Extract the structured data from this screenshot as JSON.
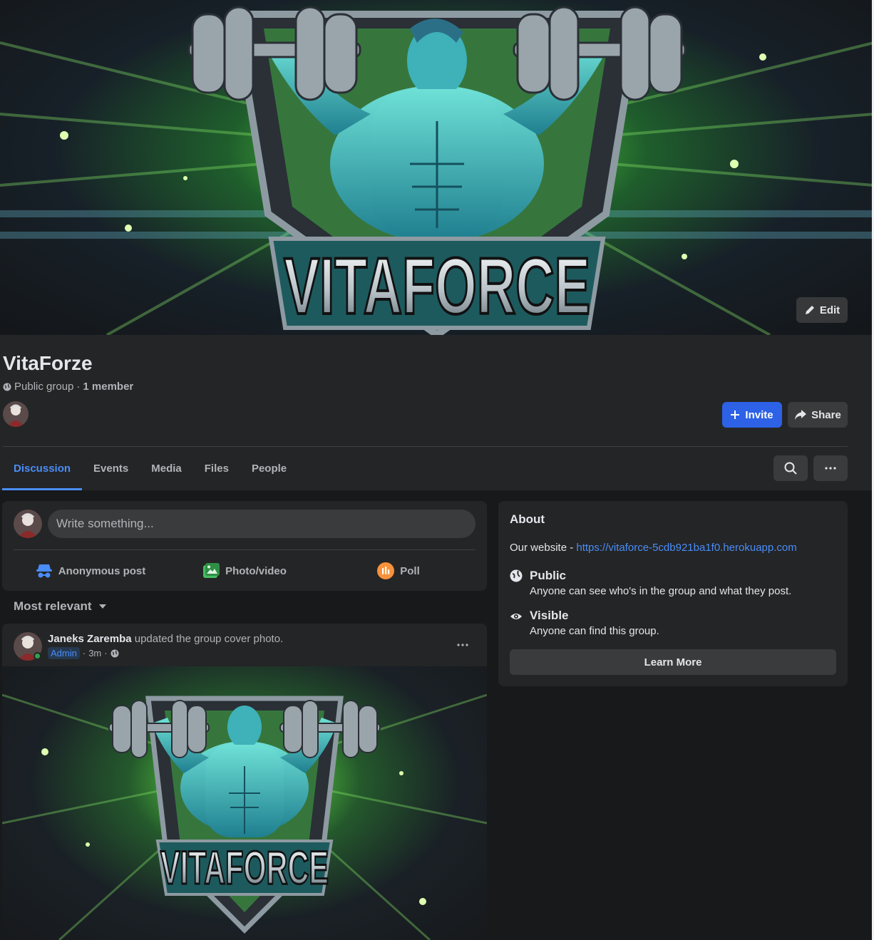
{
  "cover": {
    "image_text": "VITAFORCE",
    "edit_label": "Edit"
  },
  "group": {
    "name": "VitaForze",
    "privacy": "Public group",
    "separator": " · ",
    "member_count": "1 member"
  },
  "actions": {
    "invite_label": "Invite",
    "share_label": "Share"
  },
  "tabs": [
    {
      "label": "Discussion",
      "active": true
    },
    {
      "label": "Events"
    },
    {
      "label": "Media"
    },
    {
      "label": "Files"
    },
    {
      "label": "People"
    }
  ],
  "composer": {
    "placeholder": "Write something...",
    "actions": [
      {
        "label": "Anonymous post",
        "icon": "anonymous-icon",
        "color": "#4a8df8"
      },
      {
        "label": "Photo/video",
        "icon": "photo-icon",
        "color": "#45bd62"
      },
      {
        "label": "Poll",
        "icon": "poll-icon",
        "color": "#f7923b"
      }
    ]
  },
  "feed": {
    "sort_label": "Most relevant"
  },
  "post": {
    "author": "Janeks Zaremba",
    "action": " updated the group cover photo.",
    "badge": "Admin",
    "time": "3m",
    "image_text": "VITAFORCE"
  },
  "about": {
    "title": "About",
    "website_prefix": "Our website - ",
    "website_url": "https://vitaforce-5cdb921ba1f0.herokuapp.com",
    "public_title": "Public",
    "public_desc": "Anyone can see who's in the group and what they post.",
    "visible_title": "Visible",
    "visible_desc": "Anyone can find this group.",
    "learn_more": "Learn More"
  },
  "colors": {
    "accent": "#2d62e6",
    "link": "#4a8df8",
    "background": "#18191a",
    "surface": "#242526",
    "online": "#31a24c"
  }
}
